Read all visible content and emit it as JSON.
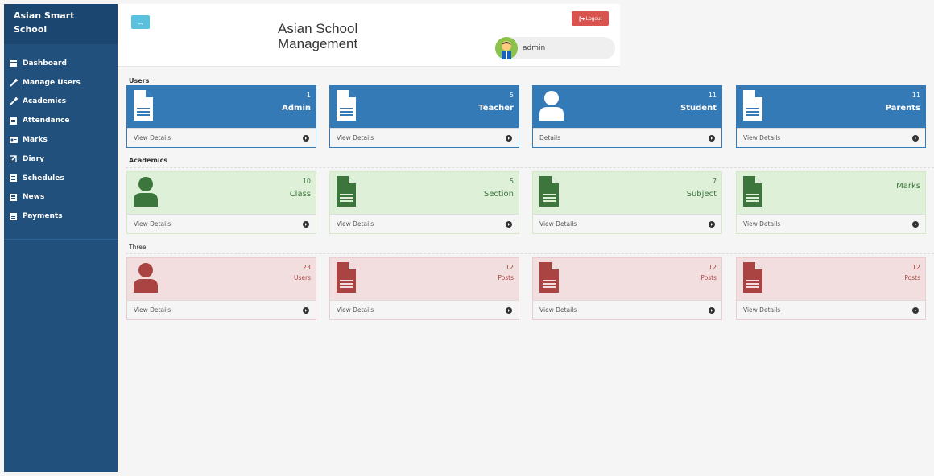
{
  "brand": {
    "line1": "Asian Smart",
    "line2": "School"
  },
  "nav": [
    {
      "label": "Dashboard",
      "icon": "dashboard-icon"
    },
    {
      "label": "Manage Users",
      "icon": "wrench-icon"
    },
    {
      "label": "Academics",
      "icon": "wrench-icon"
    },
    {
      "label": "Attendance",
      "icon": "calendar-icon"
    },
    {
      "label": "Marks",
      "icon": "id-card-icon"
    },
    {
      "label": "Diary",
      "icon": "edit-icon"
    },
    {
      "label": "Schedules",
      "icon": "list-icon"
    },
    {
      "label": "News",
      "icon": "newspaper-icon"
    },
    {
      "label": "Payments",
      "icon": "list-icon"
    }
  ],
  "header": {
    "toggle_label": "↔",
    "title_line1": "Asian School",
    "title_line2": "Management",
    "logout_label": "Logout",
    "username": "admin"
  },
  "sections": {
    "users": "Users",
    "academics": "Academics",
    "three": "Three"
  },
  "cards": {
    "users": [
      {
        "count": "1",
        "label": "Admin",
        "link": "View Details",
        "icon": "document-icon"
      },
      {
        "count": "5",
        "label": "Teacher",
        "link": "View Details",
        "icon": "document-icon"
      },
      {
        "count": "11",
        "label": "Student",
        "link": "Details",
        "icon": "user-icon"
      },
      {
        "count": "11",
        "label": "Parents",
        "link": "View Details",
        "icon": "document-icon"
      }
    ],
    "academics": [
      {
        "count": "10",
        "label": "Class",
        "link": "View Details",
        "icon": "user-icon"
      },
      {
        "count": "5",
        "label": "Section",
        "link": "View Details",
        "icon": "document-icon"
      },
      {
        "count": "7",
        "label": "Subject",
        "link": "View Details",
        "icon": "document-icon"
      },
      {
        "count": "",
        "label": "Marks",
        "link": "View Details",
        "icon": "document-icon"
      }
    ],
    "three": [
      {
        "count": "23",
        "label": "Users",
        "link": "View Details",
        "icon": "user-icon"
      },
      {
        "count": "12",
        "label": "Posts",
        "link": "View Details",
        "icon": "document-icon"
      },
      {
        "count": "12",
        "label": "Posts",
        "link": "View Details",
        "icon": "document-icon"
      },
      {
        "count": "12",
        "label": "Posts",
        "link": "View Details",
        "icon": "document-icon"
      }
    ]
  },
  "colors": {
    "sidebar": "#21507c",
    "primary": "#337ab7",
    "success_bg": "#dff0d8",
    "success_icon": "#3c763d",
    "danger_bg": "#f2dede",
    "danger_icon": "#a94442",
    "logout": "#d9534f",
    "toggle": "#5bc0de"
  }
}
